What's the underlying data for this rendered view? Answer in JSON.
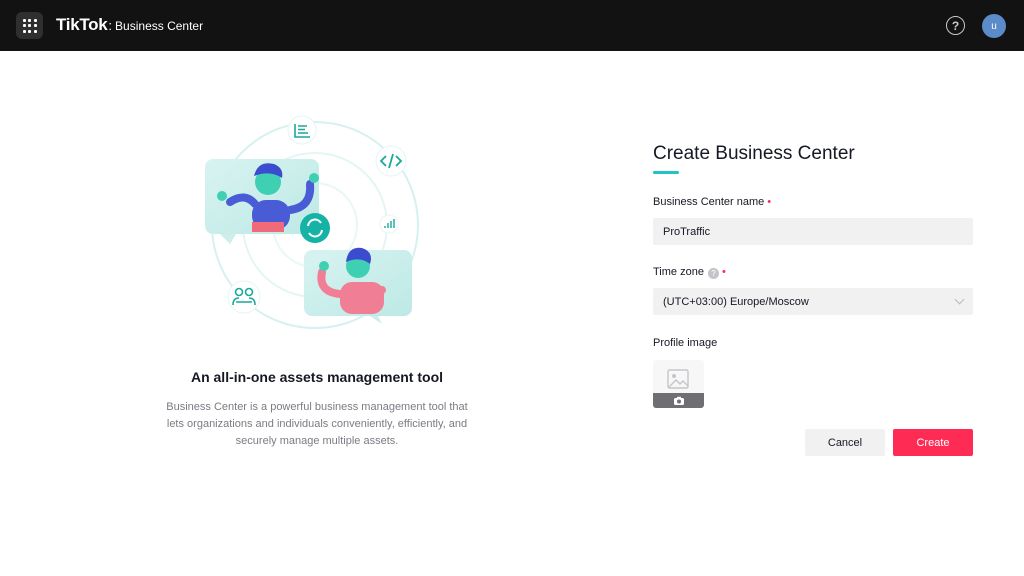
{
  "header": {
    "brand": "TikTok",
    "brand_separator": ":",
    "product": "Business Center",
    "help_symbol": "?",
    "avatar_initial": "u",
    "icons": [
      "apps-grid-icon",
      "help-icon",
      "avatar"
    ]
  },
  "illustration": {
    "icons": [
      "report-list-icon",
      "code-icon",
      "bar-chart-icon",
      "sync-icon",
      "users-icon"
    ],
    "title": "An all-in-one assets management tool",
    "description": "Business Center is a powerful business management tool that lets organizations and individuals conveniently, efficiently, and securely manage multiple assets."
  },
  "form": {
    "title": "Create Business Center",
    "name_label": "Business Center name",
    "name_value": "ProTraffic",
    "timezone_label": "Time zone",
    "timezone_value": "(UTC+03:00) Europe/Moscow",
    "profile_label": "Profile image",
    "required_mark": "•",
    "info_symbol": "?",
    "cancel_label": "Cancel",
    "create_label": "Create"
  },
  "colors": {
    "header_bg": "#121212",
    "accent_teal": "#20c3c8",
    "primary_pink": "#fe2c55",
    "input_bg": "#f1f1f2"
  }
}
